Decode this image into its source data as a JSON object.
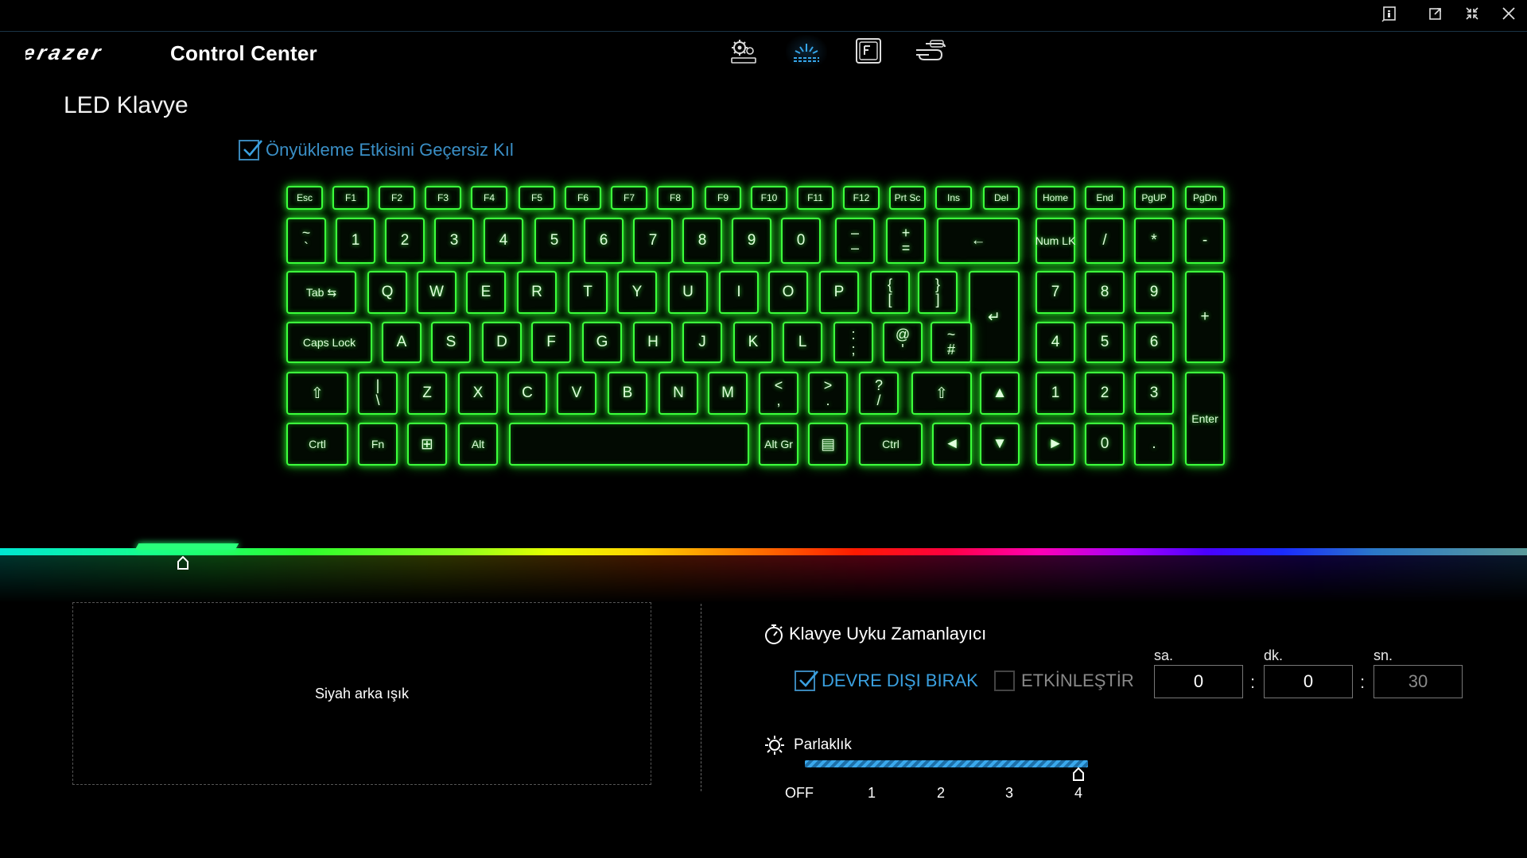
{
  "window_controls": [
    "info-icon",
    "restore-icon",
    "minimize-icon",
    "close-icon"
  ],
  "header": {
    "brand_logo_text": "erazer",
    "app_title": "Control Center",
    "tabs": [
      {
        "name": "system-settings-icon",
        "active": false
      },
      {
        "name": "led-keyboard-icon",
        "active": true
      },
      {
        "name": "function-keys-icon",
        "active": false
      },
      {
        "name": "fan-control-icon",
        "active": false
      }
    ]
  },
  "page": {
    "title": "LED Klavye",
    "override_preview_label": "Önyükleme Etkisini Geçersiz Kıl",
    "override_preview_checked": true
  },
  "keyboard": {
    "backlight_color": "#3dff3d",
    "rows": [
      [
        "Esc",
        "F1",
        "F2",
        "F3",
        "F4",
        "F5",
        "F6",
        "F7",
        "F8",
        "F9",
        "F10",
        "F11",
        "F12",
        "Prt Sc",
        "Ins",
        "Del",
        "Home",
        "End",
        "PgUP",
        "PgDn"
      ],
      [
        "~ `",
        "1",
        "2",
        "3",
        "4",
        "5",
        "6",
        "7",
        "8",
        "9",
        "0",
        "– –",
        "+ =",
        "←",
        "Num LK",
        "/",
        "*",
        "-"
      ],
      [
        "Tab ⇆",
        "Q",
        "W",
        "E",
        "R",
        "T",
        "Y",
        "U",
        "I",
        "O",
        "P",
        "{ [",
        "} ]",
        "↵",
        "7",
        "8",
        "9",
        "+"
      ],
      [
        "Caps Lock",
        "A",
        "S",
        "D",
        "F",
        "G",
        "H",
        "J",
        "K",
        "L",
        ": ;",
        "@ '",
        "~ #",
        "4",
        "5",
        "6"
      ],
      [
        "⇧",
        "| \\",
        "Z",
        "X",
        "C",
        "V",
        "B",
        "N",
        "M",
        "< ,",
        "> .",
        "? /",
        "⇧",
        "▲",
        "1",
        "2",
        "3",
        "Enter"
      ],
      [
        "Crtl",
        "Fn",
        "⊞",
        "Alt",
        "",
        "Alt Gr",
        "▤",
        "Ctrl",
        "◄",
        "▼",
        "►",
        "0",
        "."
      ]
    ]
  },
  "color_spectrum": {
    "selected_color": "#29ff7a",
    "colors": [
      "#00e6d2",
      "#2dff2d",
      "#e6ff00",
      "#ff6a00",
      "#ff1a00",
      "#ff00b4",
      "#4a00ff",
      "#2a78c8"
    ]
  },
  "preview": {
    "text": "Siyah arka ışık"
  },
  "sleep_timer": {
    "title": "Klavye Uyku Zamanlayıcı",
    "disable_label": "DEVRE DIŞI BIRAK",
    "disable_checked": true,
    "enable_label": "ETKİNLEŞTİR",
    "enable_checked": false,
    "hours_label": "sa.",
    "minutes_label": "dk.",
    "seconds_label": "sn.",
    "hours_value": "0",
    "minutes_value": "0",
    "seconds_value": "30",
    "separator": ":"
  },
  "brightness": {
    "title": "Parlaklık",
    "value": 4,
    "max": 4,
    "ticks": [
      "OFF",
      "1",
      "2",
      "3",
      "4"
    ]
  }
}
